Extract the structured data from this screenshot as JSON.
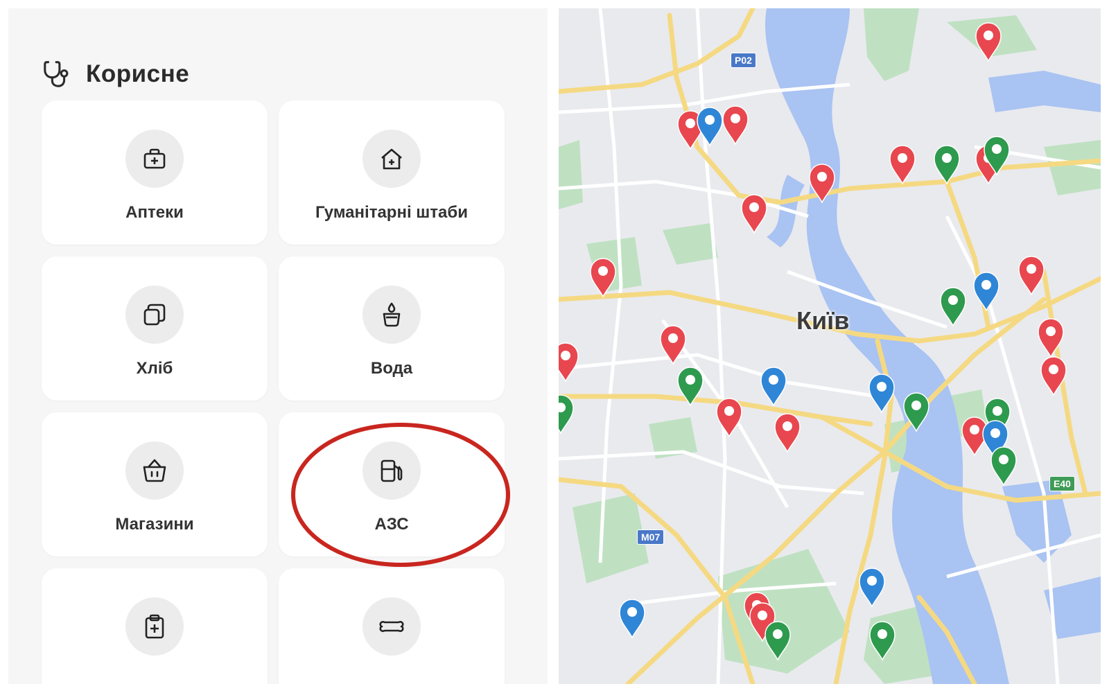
{
  "useful": {
    "title": "Корисне",
    "items": [
      {
        "label": "Аптеки",
        "icon": "first-aid-kit-icon"
      },
      {
        "label": "Гуманітарні штаби",
        "icon": "house-plus-icon"
      },
      {
        "label": "Хліб",
        "icon": "bread-icon"
      },
      {
        "label": "Вода",
        "icon": "water-icon"
      },
      {
        "label": "Магазини",
        "icon": "shopping-basket-icon"
      },
      {
        "label": "АЗС",
        "icon": "fuel-pump-icon"
      },
      {
        "label": "",
        "icon": "clipboard-plus-icon"
      },
      {
        "label": "",
        "icon": "bone-icon"
      }
    ],
    "highlighted_item": "АЗС",
    "highlight_color": "#c8261f"
  },
  "map": {
    "city_label": "Київ",
    "route_badges": [
      "Р02",
      "М07",
      "Е40"
    ],
    "pin_colors": {
      "red": "#e8474f",
      "green": "#2e9a4e",
      "blue": "#2f86d6"
    },
    "colors": {
      "land": "#e9eaee",
      "water": "#a9c3f2",
      "park": "#bfe1c2",
      "major_road": "#f5d982",
      "minor_road": "#ffffff"
    }
  }
}
